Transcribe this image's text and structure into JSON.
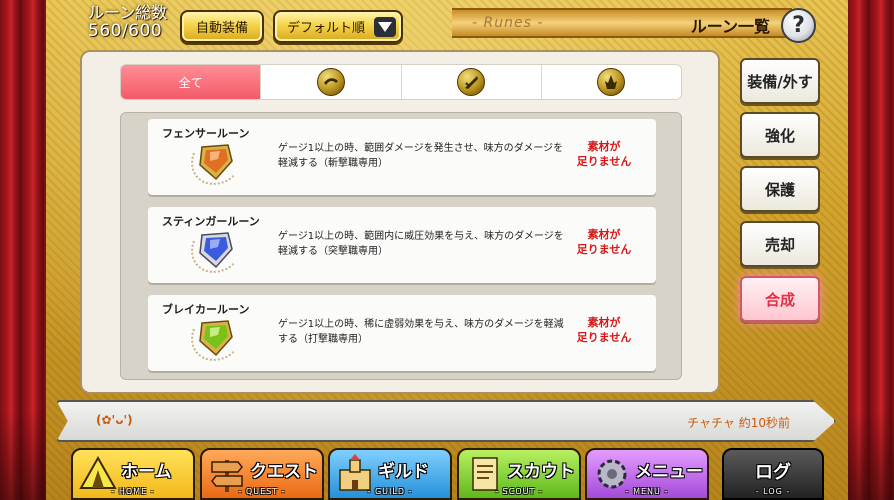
{
  "colors": {
    "accent_pink": "#f45b68",
    "status_red": "#d81818",
    "chat_orange": "#c95b10",
    "frame_gold": "#d3a52e"
  },
  "header": {
    "rune_count_label": "ルーン総数",
    "rune_count_value": "560/600",
    "auto_equip_label": "自動装備",
    "sort_label": "デフォルト順",
    "title_sub": "- Runes -",
    "title_main": "ルーン一覧",
    "help_label": "?"
  },
  "tabs": [
    {
      "label": "全て",
      "icon": "all"
    },
    {
      "label": "",
      "icon": "slash-orb-icon"
    },
    {
      "label": "",
      "icon": "pierce-orb-icon"
    },
    {
      "label": "",
      "icon": "strike-orb-icon"
    }
  ],
  "runes": [
    {
      "name": "フェンサールーン",
      "description": "ゲージ1以上の時、範囲ダメージを発生させ、味方のダメージを軽減する（斬撃職専用）",
      "status_line1": "素材が",
      "status_line2": "足りません",
      "gem_color": "#e07020"
    },
    {
      "name": "スティンガールーン",
      "description": "ゲージ1以上の時、範囲内に威圧効果を与え、味方のダメージを軽減する（突撃職専用）",
      "status_line1": "素材が",
      "status_line2": "足りません",
      "gem_color": "#3a5ae0"
    },
    {
      "name": "ブレイカールーン",
      "description": "ゲージ1以上の時、稀に虚弱効果を与え、味方のダメージを軽減する（打撃職専用）",
      "status_line1": "素材が",
      "status_line2": "足りません",
      "gem_color": "#7ac21a"
    }
  ],
  "side_menu": [
    {
      "label": "装備/外す",
      "active": false
    },
    {
      "label": "強化",
      "active": false
    },
    {
      "label": "保護",
      "active": false
    },
    {
      "label": "売却",
      "active": false
    },
    {
      "label": "合成",
      "active": true
    }
  ],
  "chat": {
    "emote": "(✿'ᴗ')",
    "log": "チャチャ 約10秒前"
  },
  "nav": {
    "home": {
      "label": "ホーム",
      "sub": "- HOME -"
    },
    "quest": {
      "label": "クエスト",
      "sub": "- QUEST -"
    },
    "guild": {
      "label": "ギルド",
      "sub": "- GUILD -"
    },
    "scout": {
      "label": "スカウト",
      "sub": "- SCOUT -"
    },
    "menu": {
      "label": "メニュー",
      "sub": "- MENU -"
    },
    "log": {
      "label": "ログ",
      "sub": "- LOG -"
    }
  }
}
